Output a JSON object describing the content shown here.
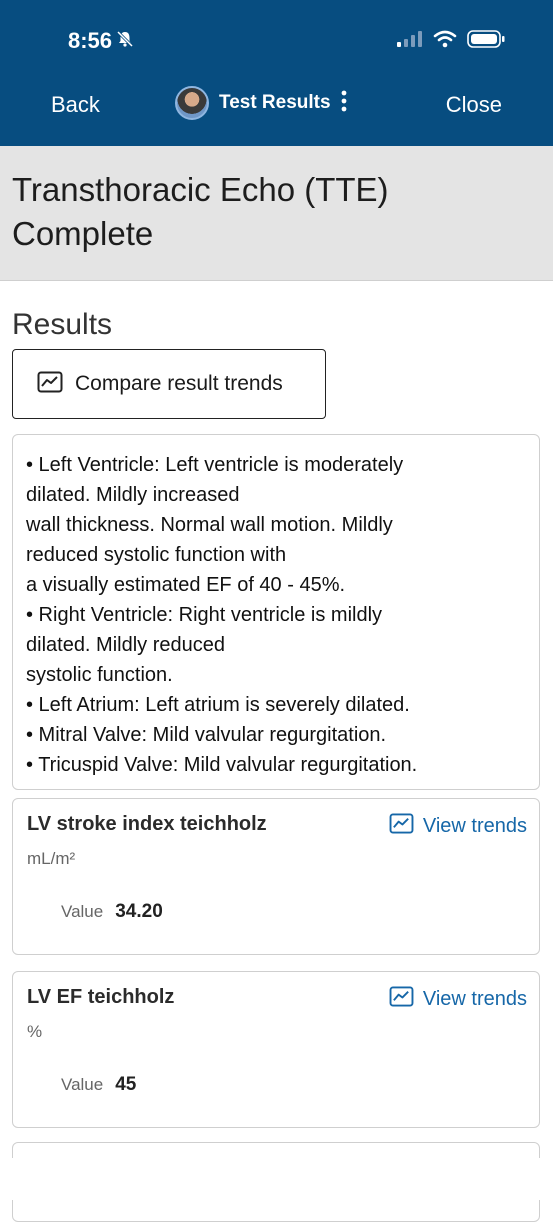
{
  "status_bar": {
    "time": "8:56"
  },
  "nav": {
    "back_label": "Back",
    "title": "Test Results",
    "close_label": "Close"
  },
  "page": {
    "title": "Transthoracic Echo (TTE) Complete"
  },
  "results": {
    "heading": "Results",
    "compare_label": "Compare result trends",
    "narrative_lines": [
      "• Left Ventricle: Left ventricle is moderately",
      "dilated. Mildly increased",
      "wall thickness. Normal wall motion. Mildly",
      "reduced systolic function with",
      "a visually estimated EF of 40 - 45%.",
      "• Right Ventricle: Right ventricle is mildly",
      "dilated. Mildly reduced",
      "systolic function.",
      "• Left Atrium: Left atrium is severely dilated.",
      "• Mitral Valve: Mild valvular regurgitation.",
      "• Tricuspid Valve: Mild valvular regurgitation."
    ],
    "items": [
      {
        "name": "LV stroke index teichholz",
        "unit": "mL/m²",
        "value_label": "Value",
        "value": "34.20",
        "trends_label": "View trends"
      },
      {
        "name": "LV EF teichholz",
        "unit": "%",
        "value_label": "Value",
        "value": "45",
        "trends_label": "View trends"
      }
    ]
  },
  "colors": {
    "header_bg": "#074d80",
    "link": "#1667a8",
    "panel_bg": "#e4e4e4"
  }
}
